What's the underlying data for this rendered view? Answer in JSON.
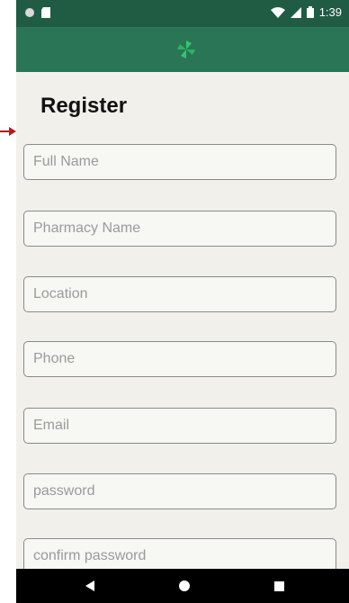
{
  "status_bar": {
    "time": "1:39",
    "icons": [
      "circle-icon",
      "sd-card-icon",
      "wifi-icon",
      "signal-icon",
      "battery-icon"
    ]
  },
  "app_bar": {
    "logo": "pinwheel-logo-icon"
  },
  "form": {
    "title": "Register",
    "fields": [
      {
        "placeholder": "Full Name"
      },
      {
        "placeholder": "Pharmacy Name"
      },
      {
        "placeholder": "Location"
      },
      {
        "placeholder": "Phone"
      },
      {
        "placeholder": "Email"
      },
      {
        "placeholder": "password"
      },
      {
        "placeholder": "confirm password"
      }
    ]
  },
  "colors": {
    "status_bar": "#1f5c43",
    "app_bar": "#2a7556",
    "background": "#f1f0ea",
    "arrow": "#b01e1e"
  },
  "nav_bar": {
    "icons": [
      "back-icon",
      "home-icon",
      "recents-icon"
    ]
  }
}
